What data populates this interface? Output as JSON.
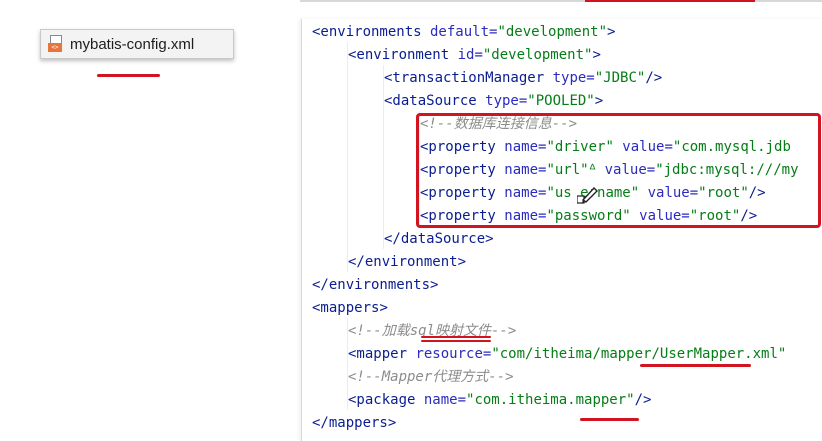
{
  "file_tab": {
    "name": "mybatis-config.xml",
    "icon": "xml-file-icon",
    "badge": "<>"
  },
  "colors": {
    "tag": "#0a1d8f",
    "attr": "#2b2bbf",
    "value": "#067d17",
    "comment": "#8c8c8c",
    "annotation": "#d1141f"
  },
  "code": [
    {
      "indent": 0,
      "tag": "<environments",
      "attrs": [
        {
          "n": " default=",
          "v": "\"development\""
        }
      ],
      "close": ">"
    },
    {
      "indent": 1,
      "tag": "<environment",
      "attrs": [
        {
          "n": " id=",
          "v": "\"development\""
        }
      ],
      "close": ">"
    },
    {
      "indent": 2,
      "tag": "<transactionManager",
      "attrs": [
        {
          "n": " type=",
          "v": "\"JDBC\""
        }
      ],
      "close": "/>"
    },
    {
      "indent": 2,
      "tag": "<dataSource",
      "attrs": [
        {
          "n": " type=",
          "v": "\"POOLED\""
        }
      ],
      "close": ">"
    },
    {
      "indent": 3,
      "comment": "<!--数据库连接信息-->"
    },
    {
      "indent": 3,
      "tag": "<property",
      "attrs": [
        {
          "n": " name=",
          "v": "\"driver\""
        },
        {
          "n": " value=",
          "v": "\"com.mysql.jdb"
        }
      ],
      "close": ""
    },
    {
      "indent": 3,
      "tag": "<property",
      "attrs": [
        {
          "n": " name=",
          "v": "\"url\"ᐞ"
        },
        {
          "n": " value=",
          "v": "\"jdbc:mysql:///my"
        }
      ],
      "close": ""
    },
    {
      "indent": 3,
      "tag": "<property",
      "attrs": [
        {
          "n": " name=",
          "v": "\"us ername\""
        },
        {
          "n": " value=",
          "v": "\"root\""
        }
      ],
      "close": "/>"
    },
    {
      "indent": 3,
      "tag": "<property",
      "attrs": [
        {
          "n": " name=",
          "v": "\"password\""
        },
        {
          "n": " value=",
          "v": "\"root\""
        }
      ],
      "close": "/>"
    },
    {
      "indent": 2,
      "tag": "</dataSource",
      "attrs": [],
      "close": ">"
    },
    {
      "indent": 1,
      "tag": "</environment",
      "attrs": [],
      "close": ">"
    },
    {
      "indent": 0,
      "tag": "</environments",
      "attrs": [],
      "close": ">"
    },
    {
      "indent": 0,
      "tag": "<mappers",
      "attrs": [],
      "close": ">"
    },
    {
      "indent": 1,
      "comment": "<!--加载sql映射文件-->"
    },
    {
      "indent": 1,
      "tag": "<mapper",
      "attrs": [
        {
          "n": " resource=",
          "v": "\"com/itheima/mapper/UserMapper.xml\""
        }
      ],
      "close": ""
    },
    {
      "indent": 1,
      "comment": "<!--Mapper代理方式-->"
    },
    {
      "indent": 1,
      "tag": "<package",
      "attrs": [
        {
          "n": " name=",
          "v": "\"com.itheima.mapper\""
        }
      ],
      "close": "/>"
    },
    {
      "indent": 0,
      "tag": "</mappers",
      "attrs": [],
      "close": ">"
    }
  ]
}
